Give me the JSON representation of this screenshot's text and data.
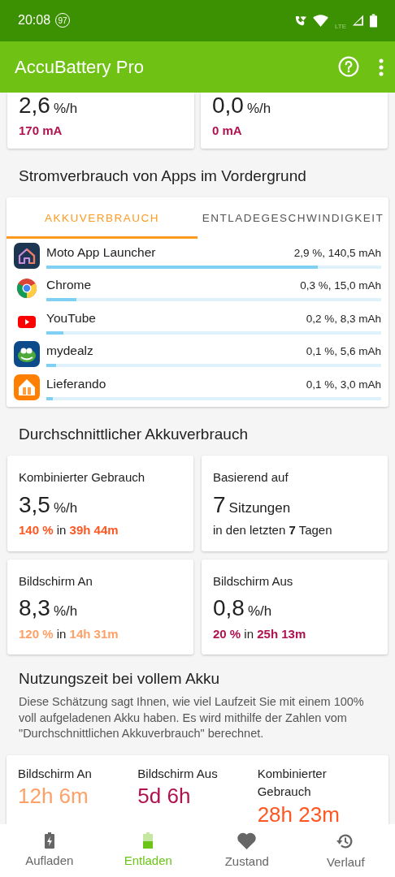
{
  "status_bar": {
    "time": "20:08",
    "badge": "97",
    "network": "LTE"
  },
  "app_bar": {
    "title": "AccuBattery Pro"
  },
  "top_cards": [
    {
      "rate": "2,6",
      "unit": "%/h",
      "current": "170 mA"
    },
    {
      "rate": "0,0",
      "unit": "%/h",
      "current": "0 mA"
    }
  ],
  "foreground_section": {
    "heading": "Stromverbrauch von Apps im Vordergrund",
    "tabs": [
      {
        "label": "AKKUVERBRAUCH",
        "selected": true
      },
      {
        "label": "ENTLADEGESCHWINDIGKEIT",
        "selected": false
      }
    ],
    "apps": [
      {
        "kind": "launcher",
        "name": "Moto App Launcher",
        "usage": "2,9 %, 140,5 mAh",
        "level": 0.81
      },
      {
        "kind": "chrome",
        "name": "Chrome",
        "usage": "0,3 %, 15,0 mAh",
        "level": 0.09
      },
      {
        "kind": "youtube",
        "name": "YouTube",
        "usage": "0,2 %, 8,3 mAh",
        "level": 0.05
      },
      {
        "kind": "mydealz",
        "name": "mydealz",
        "usage": "0,1 %, 5,6 mAh",
        "level": 0.03
      },
      {
        "kind": "lieferando",
        "name": "Lieferando",
        "usage": "0,1 %, 3,0 mAh",
        "level": 0.02
      }
    ]
  },
  "average_section": {
    "heading": "Durchschnittlicher Akkuverbrauch",
    "cards": [
      {
        "kind": "rate",
        "title": "Kombinierter Gebrauch",
        "value": "3,5",
        "unit": "%/h",
        "amount": "140 %",
        "connector": "in",
        "duration": "39h 44m",
        "color": "#ff5722"
      },
      {
        "kind": "sessions",
        "title": "Basierend auf",
        "value": "7",
        "unit": "Sitzungen",
        "note": "in den letzten **7** Tagen"
      },
      {
        "kind": "rate",
        "title": "Bildschirm An",
        "value": "8,3",
        "unit": "%/h",
        "amount": "120 %",
        "connector": "in",
        "duration": "14h 31m",
        "color": "#ffa066"
      },
      {
        "kind": "rate",
        "title": "Bildschirm Aus",
        "value": "0,8",
        "unit": "%/h",
        "amount": "20 %",
        "connector": "in",
        "duration": "25h 13m",
        "color": "#b0124f"
      }
    ]
  },
  "full_charge_section": {
    "heading": "Nutzungszeit bei vollem Akku",
    "description": "Diese Schätzung sagt Ihnen, wie viel Laufzeit Sie mit einem 100% voll aufgeladenen Akku haben. Es wird mithilfe der Zahlen vom \"Durchschnittlichen Akkuverbrauch\" berechnet.",
    "estimates": [
      {
        "label": "Bildschirm An",
        "value": "12h 6m",
        "color": "#ffa066"
      },
      {
        "label": "Bildschirm Aus",
        "value": "5d 6h",
        "color": "#b0124f"
      },
      {
        "label": "Kombinierter Gebrauch",
        "value": "28h 23m",
        "color": "#ff5722"
      }
    ]
  },
  "bottom_nav": [
    {
      "kind": "charging",
      "label": "Aufladen",
      "selected": false
    },
    {
      "kind": "discharging",
      "label": "Entladen",
      "selected": true
    },
    {
      "kind": "health",
      "label": "Zustand",
      "selected": false
    },
    {
      "kind": "history",
      "label": "Verlauf",
      "selected": false
    }
  ]
}
